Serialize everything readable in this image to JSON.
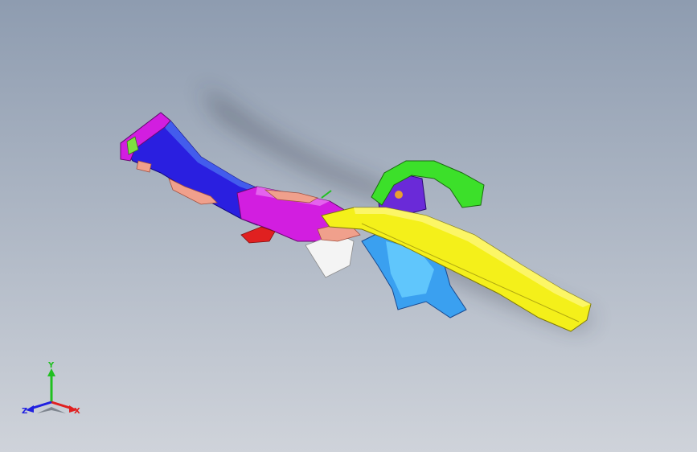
{
  "viewport": {
    "background_top": "#8e9cb0",
    "background_bottom": "#cfd3da"
  },
  "model": {
    "parts": [
      {
        "name": "blue-front-rail",
        "color": "#2a1fe0"
      },
      {
        "name": "magenta-crush-bracket",
        "color": "#d21ee0"
      },
      {
        "name": "pink-brackets",
        "color": "#f0a08c"
      },
      {
        "name": "red-mount",
        "color": "#e02020"
      },
      {
        "name": "white-plate",
        "color": "#f4f4f4"
      },
      {
        "name": "cyan-reinforcement",
        "color": "#1ec8e8"
      },
      {
        "name": "light-blue-shock-tower",
        "color": "#3aa0f0"
      },
      {
        "name": "yellow-side-rail",
        "color": "#f4f01a"
      },
      {
        "name": "green-apron-bracket",
        "color": "#3ce02a"
      },
      {
        "name": "purple-tower-inner",
        "color": "#6a2ad8"
      }
    ]
  },
  "triad": {
    "x_label": "X",
    "y_label": "Y",
    "z_label": "Z",
    "x_color": "#e02020",
    "y_color": "#20c020",
    "z_color": "#2020e0"
  }
}
